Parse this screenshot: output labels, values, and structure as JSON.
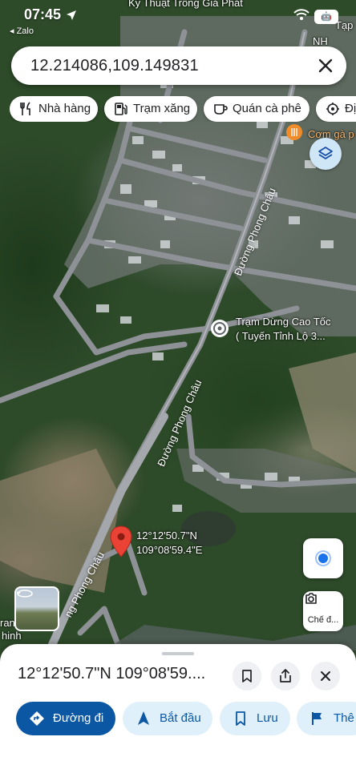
{
  "status_bar": {
    "time": "07:45",
    "back_app": "◂ Zalo",
    "battery": "🤖"
  },
  "search": {
    "query": "12.214086,109.149831"
  },
  "chips": [
    {
      "label": "Nhà hàng",
      "icon": "restaurant-icon"
    },
    {
      "label": "Trạm xăng",
      "icon": "gas-station-icon"
    },
    {
      "label": "Quán cà phê",
      "icon": "coffee-icon"
    },
    {
      "label": "Địa",
      "icon": "attraction-icon"
    }
  ],
  "map_labels": {
    "top_business": "Kỹ Thuật Trồng Giá Phát",
    "top_right_1": "Tạp",
    "top_right_2": "NH",
    "com_ga": "Cơm gà p",
    "bus_stop_line1": "Trạm Dừng Cao Tốc",
    "bus_stop_line2": "( Tuyến Tỉnh Lộ 3...",
    "road_upper": "Đường Phong Châu",
    "road_middle": "Đường Phong Châu",
    "road_lower": "ng Phong Châu",
    "left_edge_1": "ran",
    "left_edge_2": "hinh"
  },
  "pin": {
    "lat": "12°12'50.7\"N",
    "lng": "109°08'59.4\"E",
    "color": "#ea4335"
  },
  "controls": {
    "street_view_label": "Chế đ..."
  },
  "sheet": {
    "title": "12°12'50.7\"N 109°08'59....",
    "actions": [
      {
        "label": "Đường đi",
        "icon": "directions-icon",
        "primary": true
      },
      {
        "label": "Bắt đầu",
        "icon": "navigation-arrow-icon",
        "primary": false
      },
      {
        "label": "Lưu",
        "icon": "bookmark-icon",
        "primary": false
      },
      {
        "label": "Thê",
        "icon": "flag-icon",
        "primary": false
      }
    ]
  },
  "colors": {
    "accent": "#0b57a4",
    "accent_light": "#dff0fb",
    "location_blue": "#1a73e8"
  }
}
